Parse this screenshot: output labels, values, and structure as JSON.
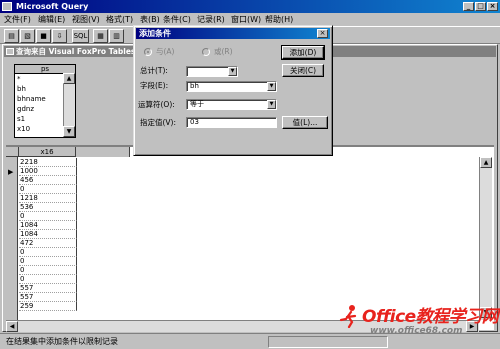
{
  "app": {
    "title": "Microsoft Query"
  },
  "menu": [
    "文件(F)",
    "编辑(E)",
    "视图(V)",
    "格式(T)",
    "表(B)",
    "条件(C)",
    "记录(R)",
    "窗口(W)",
    "帮助(H)"
  ],
  "toolbar": {
    "sql_label": "SQL"
  },
  "query_window": {
    "title": "查询来自 Visual FoxPro Tables",
    "table": {
      "name": "ps",
      "fields": [
        "*",
        "bh",
        "bhname",
        "gdnz",
        "s1",
        "x10"
      ]
    },
    "grid": {
      "column": "x16",
      "rows": [
        "2218",
        "1000",
        "456",
        "0",
        "1218",
        "536",
        "0",
        "1084",
        "1084",
        "472",
        "0",
        "0",
        "0",
        "0",
        "557",
        "557",
        "259"
      ]
    }
  },
  "dialog": {
    "title": "添加条件",
    "and_label": "与(A)",
    "or_label": "或(R)",
    "total_label": "总计(T):",
    "total_value": "",
    "field_label": "字段(E):",
    "field_value": "bh",
    "operator_label": "运算符(O):",
    "operator_value": "等于",
    "value_label": "指定值(V):",
    "value_value": "03",
    "add_button": "添加(D)",
    "close_button": "关闭(C)",
    "values_button": "值(L)..."
  },
  "status": {
    "text": "在结果集中添加条件以限制记录"
  },
  "watermark": {
    "main": "Office教程学习网",
    "url": "www.office68.com"
  }
}
